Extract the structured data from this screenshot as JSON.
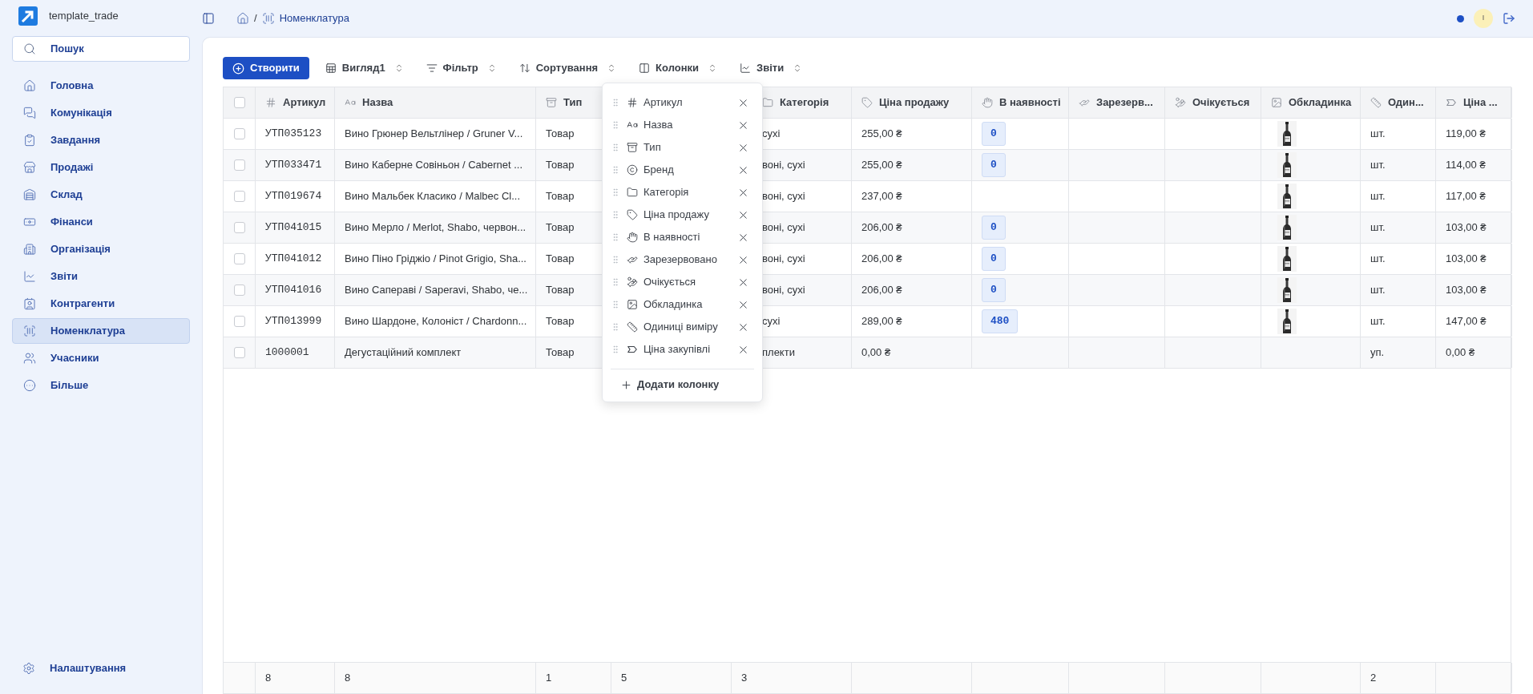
{
  "app": {
    "name": "template_trade"
  },
  "search": {
    "label": "Пошук"
  },
  "nav": [
    {
      "label": "Головна",
      "selected": false
    },
    {
      "label": "Комунікація",
      "selected": false
    },
    {
      "label": "Завдання",
      "selected": false
    },
    {
      "label": "Продажі",
      "selected": false
    },
    {
      "label": "Склад",
      "selected": false
    },
    {
      "label": "Фінанси",
      "selected": false
    },
    {
      "label": "Організація",
      "selected": false
    },
    {
      "label": "Звіти",
      "selected": false
    },
    {
      "label": "Контрагенти",
      "selected": false
    },
    {
      "label": "Номенклатура",
      "selected": true
    },
    {
      "label": "Учасники",
      "selected": false
    },
    {
      "label": "Більше",
      "selected": false
    }
  ],
  "settings": {
    "label": "Налаштування"
  },
  "breadcrumb": {
    "separator": "/",
    "current": "Номенклатура"
  },
  "user": {
    "initial": "I"
  },
  "toolbar": {
    "create": "Створити",
    "buttons": [
      "Вигляд1",
      "Фільтр",
      "Сортування",
      "Колонки",
      "Звіти"
    ]
  },
  "table": {
    "header_checked": false,
    "columns": [
      {
        "label": "Артикул",
        "footer": "8"
      },
      {
        "label": "Назва",
        "footer": "8"
      },
      {
        "label": "Тип",
        "footer": "1"
      },
      {
        "footer": "5"
      },
      {
        "label": "Категорія",
        "footer": "3"
      },
      {
        "label": "Ціна продажу"
      },
      {
        "label": "В наявності"
      },
      {
        "label": "Зарезерв..."
      },
      {
        "label": "Очікується"
      },
      {
        "label": "Обкладинка"
      },
      {
        "label": "Один...",
        "footer": "2"
      },
      {
        "label": "Ціна ..."
      }
    ],
    "rows": [
      {
        "checked": false,
        "article": "УТП035123",
        "name": "Вино Грюнер Вельтлінер / Gruner V...",
        "type": "Товар",
        "category": "сухі",
        "price": "255,00 ₴",
        "stock": "0",
        "unit": "шт.",
        "purchase": "119,00 ₴"
      },
      {
        "checked": false,
        "article": "УТП033471",
        "name": "Вино Каберне Совіньон / Cabernet ...",
        "type": "Товар",
        "category": "воні, сухі",
        "price": "255,00 ₴",
        "stock": "0",
        "unit": "шт.",
        "purchase": "114,00 ₴"
      },
      {
        "checked": false,
        "article": "УТП019674",
        "name": "Вино Мальбек Класико / Malbec Cl...",
        "type": "Товар",
        "category": "воні, сухі",
        "price": "237,00 ₴",
        "unit": "шт.",
        "purchase": "117,00 ₴"
      },
      {
        "checked": false,
        "article": "УТП041015",
        "name": "Вино Мерло / Merlot, Shabo, червон...",
        "type": "Товар",
        "category": "воні, сухі",
        "price": "206,00 ₴",
        "stock": "0",
        "unit": "шт.",
        "purchase": "103,00 ₴"
      },
      {
        "checked": false,
        "article": "УТП041012",
        "name": "Вино Піно Гріджіо / Pinot Grigio, Sha...",
        "type": "Товар",
        "category": "воні, сухі",
        "price": "206,00 ₴",
        "stock": "0",
        "unit": "шт.",
        "purchase": "103,00 ₴"
      },
      {
        "checked": false,
        "article": "УТП041016",
        "name": "Вино Сапераві / Saperavi, Shabo, че...",
        "type": "Товар",
        "category": "воні, сухі",
        "price": "206,00 ₴",
        "stock": "0",
        "unit": "шт.",
        "purchase": "103,00 ₴"
      },
      {
        "checked": false,
        "article": "УТП013999",
        "name": "Вино Шардоне, Колоніст / Chardonn...",
        "type": "Товар",
        "category": "сухі",
        "price": "289,00 ₴",
        "stock": "480",
        "unit": "шт.",
        "purchase": "147,00 ₴"
      },
      {
        "checked": false,
        "article": "1000001",
        "name": "Дегустаційний комплект",
        "type": "Товар",
        "category": "плекти",
        "price": "0,00 ₴",
        "unit": "уп.",
        "purchase": "0,00 ₴"
      }
    ]
  },
  "column_menu": {
    "items": [
      {
        "label": "Артикул"
      },
      {
        "label": "Назва"
      },
      {
        "label": "Тип"
      },
      {
        "label": "Бренд"
      },
      {
        "label": "Категорія"
      },
      {
        "label": "Ціна продажу"
      },
      {
        "label": "В наявності"
      },
      {
        "label": "Зарезервовано"
      },
      {
        "label": "Очікується"
      },
      {
        "label": "Обкладинка"
      },
      {
        "label": "Одиниці виміру"
      },
      {
        "label": "Ціна закупівлі"
      }
    ],
    "add": "Додати колонку"
  }
}
